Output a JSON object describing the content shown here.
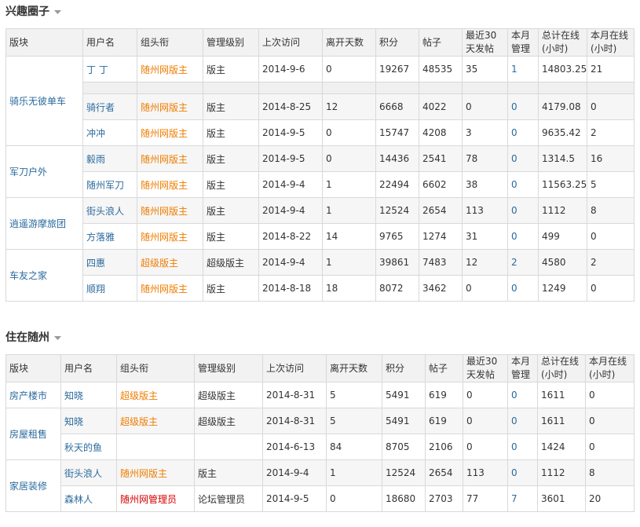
{
  "colors": {
    "link": "#2a6a9e",
    "rank_orange": "#ef7d00",
    "rank_red": "#d60000",
    "header_bg": "#f2f2f2"
  },
  "section1": {
    "title": "兴趣圈子",
    "headers": [
      "版块",
      "用户名",
      "组头衔",
      "管理级别",
      "上次访问",
      "离开天数",
      "积分",
      "帖子",
      "最近30天发帖",
      "本月管理",
      "总计在线(小时)",
      "本月在线(小时)"
    ],
    "groups": [
      {
        "forum": "骑乐无彼单车",
        "rows": [
          [
            "丁 丁",
            "随州网版主",
            "版主",
            "2014-9-6",
            "0",
            "19267",
            "48535",
            "35",
            "1",
            "14803.25",
            "21"
          ],
          [
            "骑行者",
            "随州网版主",
            "版主",
            "2014-8-25",
            "12",
            "6668",
            "4022",
            "0",
            "0",
            "4179.08",
            "0"
          ],
          [
            "冲冲",
            "随州网版主",
            "版主",
            "2014-9-5",
            "0",
            "15747",
            "4208",
            "3",
            "0",
            "9635.42",
            "2"
          ]
        ]
      },
      {
        "forum": "军刀户外",
        "rows": [
          [
            "毅雨",
            "随州网版主",
            "版主",
            "2014-9-5",
            "0",
            "14436",
            "2541",
            "78",
            "0",
            "1314.5",
            "16"
          ],
          [
            "随州军刀",
            "随州网版主",
            "版主",
            "2014-9-4",
            "1",
            "22494",
            "6602",
            "38",
            "0",
            "11563.25",
            "5"
          ]
        ]
      },
      {
        "forum": "逍遥游摩旅团",
        "rows": [
          [
            "街头浪人",
            "随州网版主",
            "版主",
            "2014-9-4",
            "1",
            "12524",
            "2654",
            "113",
            "0",
            "1112",
            "8"
          ],
          [
            "方落雅",
            "随州网版主",
            "版主",
            "2014-8-22",
            "14",
            "9765",
            "1274",
            "31",
            "0",
            "499",
            "0"
          ]
        ]
      },
      {
        "forum": "车友之家",
        "rows": [
          [
            "四惠",
            "超级版主",
            "超级版主",
            "2014-9-4",
            "1",
            "39861",
            "7483",
            "12",
            "2",
            "4580",
            "2"
          ],
          [
            "顺翔",
            "随州网版主",
            "版主",
            "2014-8-18",
            "18",
            "8072",
            "3462",
            "0",
            "0",
            "1249",
            "0"
          ]
        ]
      }
    ]
  },
  "section2": {
    "title": "住在随州",
    "headers": [
      "版块",
      "用户名",
      "组头衔",
      "管理级别",
      "上次访问",
      "离开天数",
      "积分",
      "帖子",
      "最近30天发帖",
      "本月管理",
      "总计在线(小时)",
      "本月在线(小时)"
    ],
    "groups": [
      {
        "forum": "房产楼市",
        "rows": [
          [
            "知晓",
            "超级版主",
            "超级版主",
            "2014-8-31",
            "5",
            "5491",
            "619",
            "0",
            "0",
            "1611",
            "0"
          ]
        ]
      },
      {
        "forum": "房屋租售",
        "rows": [
          [
            "知晓",
            "超级版主",
            "超级版主",
            "2014-8-31",
            "5",
            "5491",
            "619",
            "0",
            "0",
            "1611",
            "0"
          ],
          [
            "秋天的鱼",
            "",
            "",
            "2014-6-13",
            "84",
            "8705",
            "2106",
            "0",
            "0",
            "1424",
            "0"
          ]
        ]
      },
      {
        "forum": "家居装修",
        "rows": [
          [
            "街头浪人",
            "随州网版主",
            "版主",
            "2014-9-4",
            "1",
            "12524",
            "2654",
            "113",
            "0",
            "1112",
            "8"
          ],
          [
            "森林人",
            "随州网管理员",
            "论坛管理员",
            "2014-9-5",
            "0",
            "18680",
            "2703",
            "77",
            "7",
            "3601",
            "20"
          ]
        ]
      }
    ]
  }
}
